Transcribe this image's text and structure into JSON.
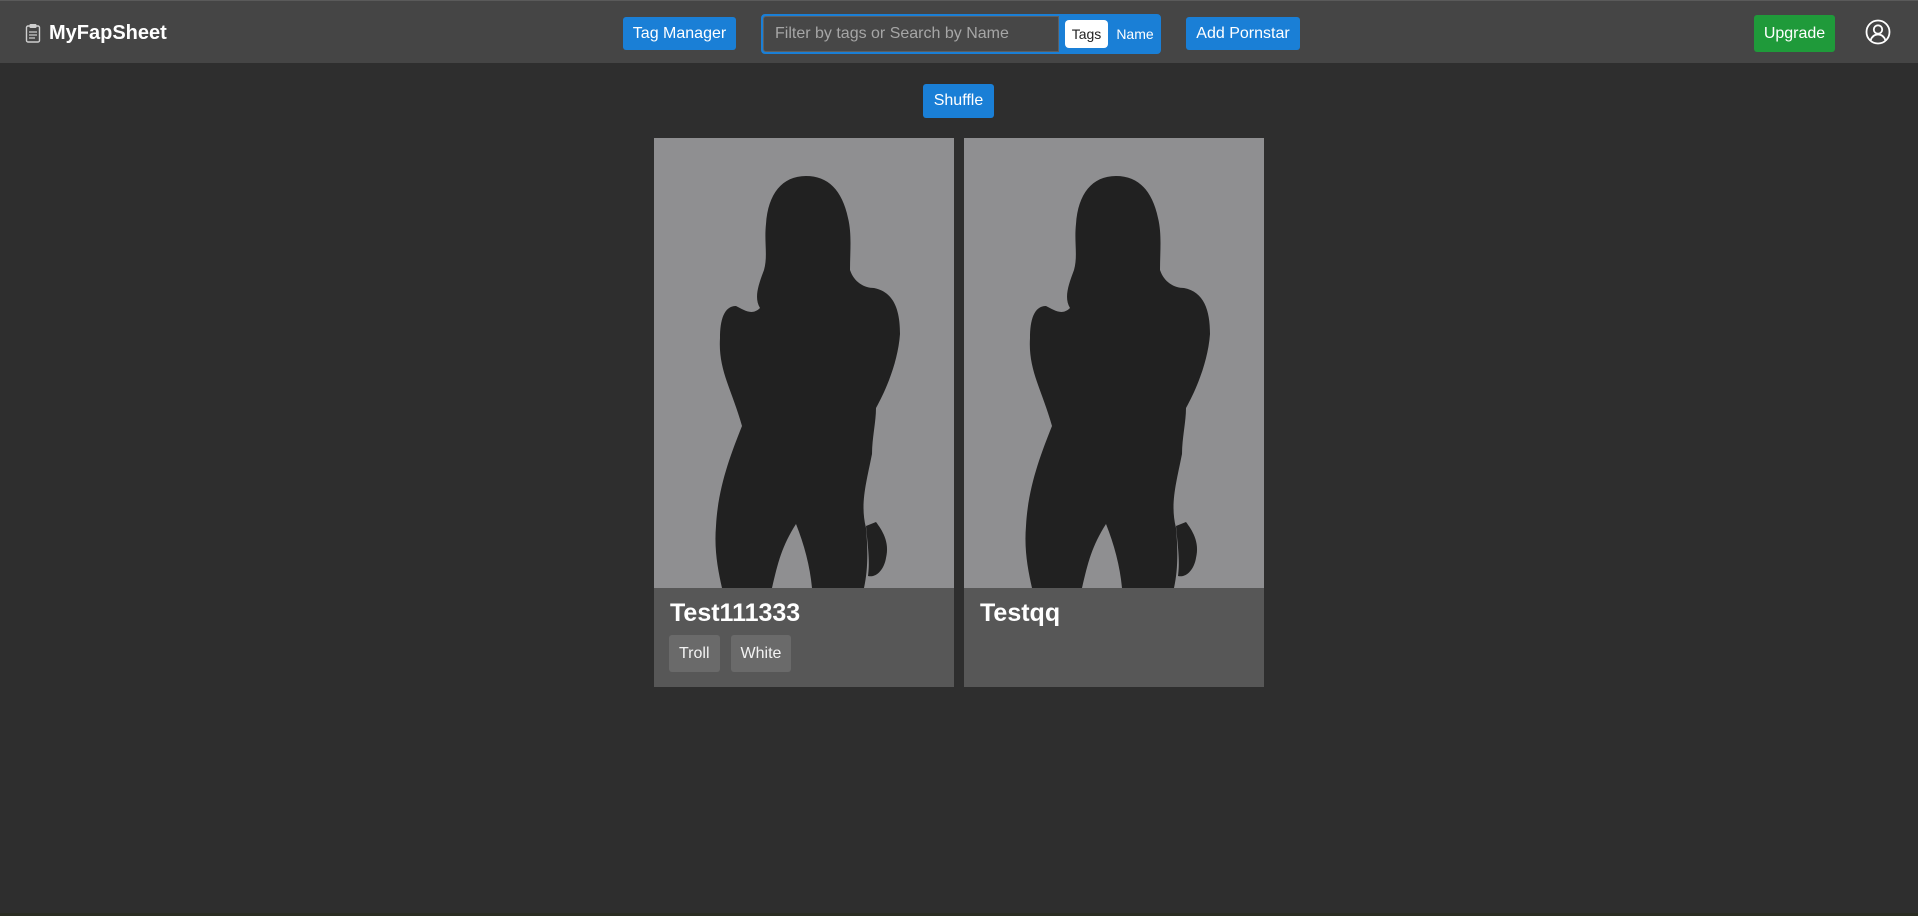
{
  "navbar": {
    "brand": "MyFapSheet",
    "tag_manager_label": "Tag Manager",
    "search_placeholder": "Filter by tags or Search by Name",
    "search_value": "",
    "toggle_tags_label": "Tags",
    "toggle_name_label": "Name",
    "toggle_selected": "Tags",
    "add_label": "Add Pornstar",
    "upgrade_label": "Upgrade",
    "brand_icon": "clipboard-icon",
    "user_icon": "user-circle-icon"
  },
  "main": {
    "shuffle_label": "Shuffle",
    "cards": [
      {
        "name": "Test111333",
        "tags": [
          "Troll",
          "White"
        ]
      },
      {
        "name": "Testqq",
        "tags": []
      }
    ]
  },
  "colors": {
    "background": "#2e2e2e",
    "navbar": "#454545",
    "accent_blue": "#1a7fd6",
    "upgrade_green": "#1f9a3a",
    "card": "#575757",
    "photo_bg": "#8f8f91",
    "silhouette": "#212121"
  }
}
